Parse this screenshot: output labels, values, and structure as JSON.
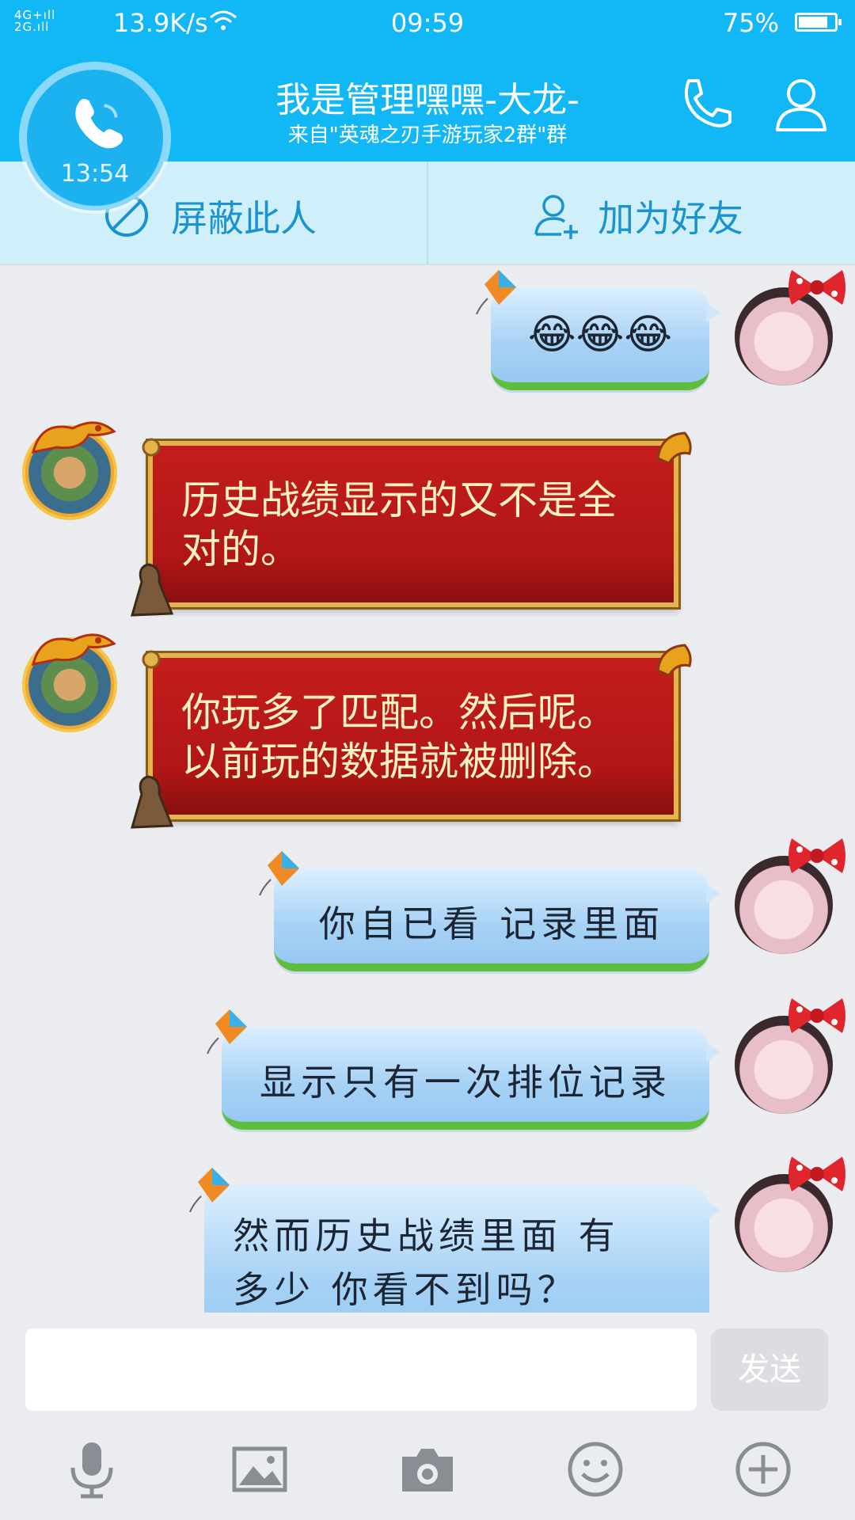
{
  "status_bar": {
    "network": "4G 2G",
    "speed": "13.9K/s",
    "time": "09:59",
    "battery": "75%"
  },
  "header": {
    "title": "我是管理嘿嘿-大龙-",
    "subtitle": "来自\"英魂之刃手游玩家2群\"群",
    "call_timer": "13:54"
  },
  "actions": {
    "block_label": "屏蔽此人",
    "add_friend_label": "加为好友"
  },
  "messages": [
    {
      "sender": "self",
      "text": "😂😂😂"
    },
    {
      "sender": "other",
      "text": "历史战绩显示的又不是全对的。"
    },
    {
      "sender": "other",
      "text": "你玩多了匹配。然后呢。以前玩的数据就被删除。"
    },
    {
      "sender": "self",
      "text": "你自已看 记录里面"
    },
    {
      "sender": "self",
      "text": "显示只有一次排位记录"
    },
    {
      "sender": "self",
      "text": "然而历史战绩里面 有多少 你看不到吗？"
    }
  ],
  "input": {
    "value": "",
    "send_label": "发送"
  },
  "toolbar": {
    "icons": [
      "microphone-icon",
      "image-icon",
      "camera-icon",
      "emoji-icon",
      "plus-icon"
    ]
  },
  "colors": {
    "header_blue": "#12b7f5",
    "action_text": "#1a93cf",
    "red_bubble": "#c41d1d",
    "red_text": "#fff3c2"
  }
}
